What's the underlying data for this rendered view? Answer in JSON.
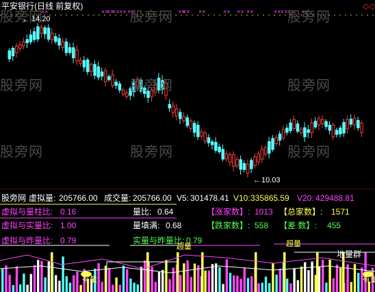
{
  "header": {
    "title": "平安银行(日线 前复权)",
    "title_color": "#ffffff",
    "nav_diamond_color": "#ff3333"
  },
  "price_chart": {
    "high_label": "14.20",
    "low_label": "10.03",
    "up_color": "#ff3c3c",
    "down_color": "#54ffff",
    "marker_color": "#ff44ff"
  },
  "watermark": {
    "text": "股旁网",
    "color": "#4a4a4a"
  },
  "volume_bar": {
    "brand": "股旁网",
    "virtual_volume_label": "虚拟量:",
    "virtual_volume_value": "205766.00",
    "turnover_label": "成交量:",
    "turnover_value": "205766.00",
    "v5_label": "V5:",
    "v5_value": "301478.41",
    "v10_label": "V10:",
    "v10_value": "335865.59",
    "v20_label": "V20:",
    "v20_value": "429488.81"
  },
  "indicators": {
    "xu_liang_zhu_label": "虚拟与量柱比:",
    "xu_liang_zhu_value": "0.16",
    "liang_bi_label": "量比:",
    "liang_bi_value": "0.64",
    "zhang_jia_label": "【涨家数】:",
    "zhang_jia_value": "1013",
    "zong_jia_label": "【总家数】:",
    "zong_jia_value": "1571",
    "xu_shi_liang_label": "虚拟与实量比:",
    "xu_shi_liang_value": "1.00",
    "liang_tian_man_label": "量填满:",
    "liang_tian_man_value": "0.68",
    "die_jia_label": "【跌家数】:",
    "die_jia_value": "558",
    "cha_shu_label": "【差  数】:",
    "cha_shu_value": "455",
    "xu_zuo_liang_label": "虚拟与昨量比:",
    "xu_zuo_liang_value": "0.79",
    "shi_zuo_liang_label": "实量与昨量比:",
    "shi_zuo_liang_value": "0.79"
  },
  "volume_chart": {
    "chao_liang_1": "超量",
    "chao_liang_2": "超量",
    "di_liang_qun": "地量群",
    "you_liang": "有量",
    "you_liang_2": "有量"
  },
  "colors": {
    "magenta": "#ff44ff",
    "yellow": "#ffff54",
    "green": "#54ff54",
    "white": "#ffffff",
    "cyan": "#54ffff"
  }
}
